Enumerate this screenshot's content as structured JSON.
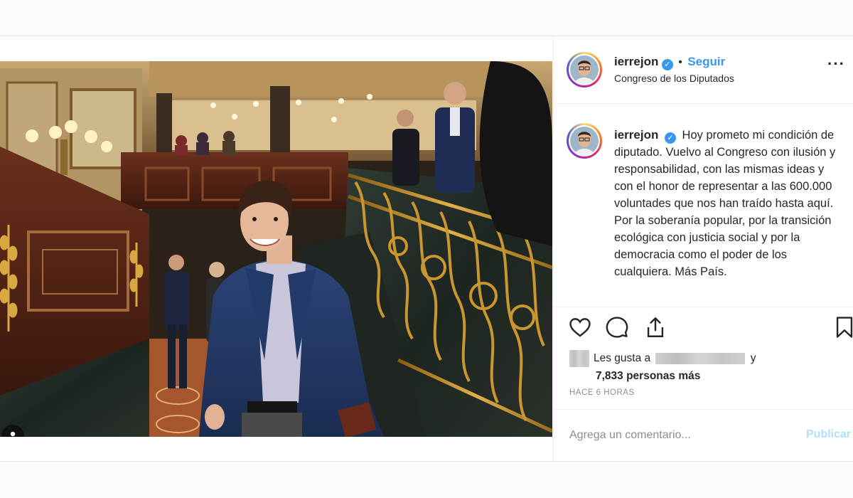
{
  "post": {
    "username": "ierrejon",
    "follow_label": "Seguir",
    "location": "Congreso de los Diputados",
    "caption": "Hoy prometo mi condición de diputado. Vuelvo al Congreso con ilusión y responsabilidad, con las mismas ideas y con el honor de representar a las 600.000 voluntades que nos han traído hasta aquí.\nPor la soberanía popular, por la transición ecológica con justicia social y por la democracia como el poder de los cualquiera. Más País.",
    "likes_prefix": "Les gusta a",
    "likes_conjunction": "y",
    "likes_count": "7,833 personas más",
    "timestamp": "HACE 6 HORAS",
    "comment_placeholder": "Agrega un comentario...",
    "publish_label": "Publicar"
  },
  "colors": {
    "accent": "#3897f0",
    "publish_disabled": "#b2dffc",
    "verified": "#3897f0"
  },
  "icons": [
    "heart-icon",
    "comment-icon",
    "share-icon",
    "bookmark-icon",
    "user-tag-icon",
    "verified-icon",
    "more-options-icon"
  ]
}
